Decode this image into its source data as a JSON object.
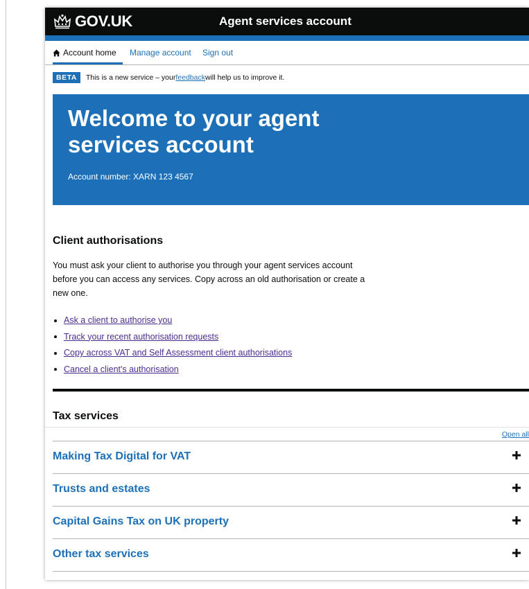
{
  "header": {
    "logo_text": "GOV.UK",
    "service_name": "Agent services account",
    "colors": {
      "header_bg": "#0b0c0c",
      "brand_blue": "#1d70b8"
    }
  },
  "nav": {
    "items": [
      {
        "label": "Account home",
        "icon": "home-icon",
        "active": true
      },
      {
        "label": "Manage account"
      },
      {
        "label": "Sign out"
      }
    ]
  },
  "beta": {
    "tag": "BETA",
    "text_before": "This is a new service – your ",
    "link": "feedback",
    "text_after": " will help us to improve it."
  },
  "banner": {
    "title": "Welcome to your agent services account",
    "account_number": "Account number: XARN 123 4567"
  },
  "client_auth": {
    "title": "Client authorisations",
    "description": "You must ask your client to authorise you through your agent services account before you can access any services. Copy across an old authorisation or create a new one.",
    "links": [
      "Ask a client to authorise you",
      "Track your recent authorisation requests",
      "Copy across VAT and Self Assessment client authorisations",
      "Cancel a client's authorisation"
    ]
  },
  "tax_services": {
    "title": "Tax services",
    "open_all": "Open all",
    "items": [
      "Making Tax Digital for VAT",
      "Trusts and estates",
      "Capital Gains Tax on UK property",
      "Other tax services"
    ]
  }
}
